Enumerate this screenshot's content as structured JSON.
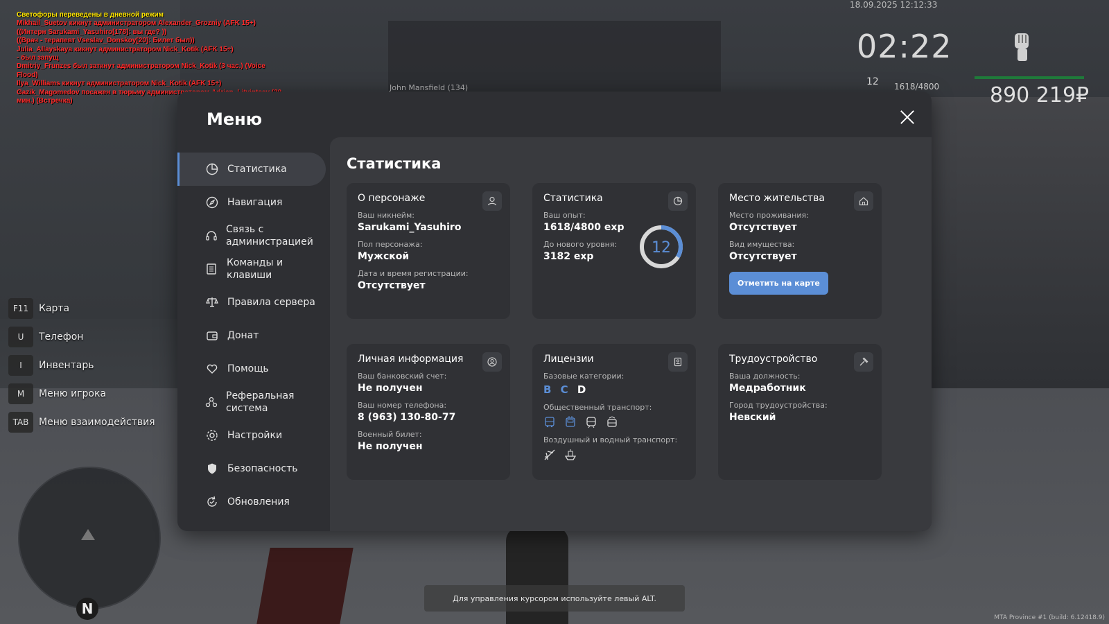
{
  "chat": {
    "lines": [
      "Светофоры переведены в дневной режим",
      "Mikhail_Suetov кикнут администратором Alexander_Grozniy (AFK 15+)",
      "((Интерн Sarukami_Yasuhiro[178]: вы где? ))",
      "((Врач - терапевт Vseslav_Donskoy[20]: Билет был))",
      "Julia_Allayskaya кикнут администратором Nick_Kotik (AFK 15+)",
      " - был запущ",
      "Dmitriy_Frunzes был заткнут администратором Nick_Kotik (3 час.) (Voice Flood)",
      "Ilya_Williams кикнут администратором Nick_Kotik (AFK 15+)",
      "Gazik_Magomedov посажен в тюрьму администратором Adrian_Litvintsev (30 мин.) (Встречка)"
    ]
  },
  "hud": {
    "datetime": "18.09.2025 12:12:33",
    "clock": "02:22",
    "level": "12",
    "exp": "1618/4800",
    "money": "890 219₽",
    "nametag": "John Mansfield (134)"
  },
  "hotkeys": [
    {
      "key": "F11",
      "label": "Карта"
    },
    {
      "key": "U",
      "label": "Телефон"
    },
    {
      "key": "I",
      "label": "Инвентарь"
    },
    {
      "key": "M",
      "label": "Меню игрока"
    },
    {
      "key": "TAB",
      "label": "Меню взаимодействия"
    }
  ],
  "minimap": {
    "north": "N"
  },
  "hint": "Для управления курсором используйте левый ALT.",
  "build": "MTA Province #1 (build: 6.12418.9)",
  "menu": {
    "title": "Меню",
    "sidebar": [
      {
        "label": "Статистика",
        "icon": "pie-chart-icon",
        "active": true
      },
      {
        "label": "Навигация",
        "icon": "compass-icon"
      },
      {
        "label": "Связь с администрацией",
        "icon": "headset-icon"
      },
      {
        "label": "Команды и клавиши",
        "icon": "document-icon"
      },
      {
        "label": "Правила сервера",
        "icon": "scales-icon"
      },
      {
        "label": "Донат",
        "icon": "wallet-icon"
      },
      {
        "label": "Помощь",
        "icon": "heart-hand-icon"
      },
      {
        "label": "Реферальная система",
        "icon": "referral-icon"
      },
      {
        "label": "Настройки",
        "icon": "gear-icon"
      },
      {
        "label": "Безопасность",
        "icon": "shield-icon"
      },
      {
        "label": "Обновления",
        "icon": "refresh-icon"
      }
    ],
    "content_title": "Статистика",
    "cards": {
      "character": {
        "title": "О персонаже",
        "nick_label": "Ваш никнейм:",
        "nick": "Sarukami_Yasuhiro",
        "gender_label": "Пол персонажа:",
        "gender": "Мужской",
        "reg_label": "Дата и время регистрации:",
        "reg": "Отсутствует"
      },
      "stats": {
        "title": "Статистика",
        "exp_label": "Ваш опыт:",
        "exp": "1618/4800 exp",
        "next_label": "До нового уровня:",
        "next": "3182 exp",
        "level": "12",
        "progress": 0.337
      },
      "residence": {
        "title": "Место жительства",
        "place_label": "Место проживания:",
        "place": "Отсутствует",
        "property_label": "Вид имущества:",
        "property": "Отсутствует",
        "button": "Отметить на карте"
      },
      "personal": {
        "title": "Личная информация",
        "bank_label": "Ваш банковский счет:",
        "bank": "Не получен",
        "phone_label": "Ваш номер телефона:",
        "phone": "8 (963) 130-80-77",
        "military_label": "Военный билет:",
        "military": "Не получен"
      },
      "licenses": {
        "title": "Лицензии",
        "base_label": "Базовые категории:",
        "cat_b": "B",
        "cat_c": "C",
        "cat_d": "D",
        "public_label": "Общественный транспорт:",
        "public_icons": [
          "bus-icon",
          "trolleybus-icon",
          "train-icon",
          "tram-icon"
        ],
        "air_label": "Воздушный и водный транспорт:",
        "air_icons": [
          "airplane-icon",
          "boat-icon"
        ]
      },
      "job": {
        "title": "Трудоустройство",
        "position_label": "Ваша должность:",
        "position": "Медработник",
        "city_label": "Город трудоустройства:",
        "city": "Невский"
      }
    }
  },
  "colors": {
    "accent": "#5b8ed6",
    "panel": "#2e2f33",
    "content": "#393a3e",
    "card": "#303135",
    "chat_red": "#ff2a2a",
    "chat_yellow": "#ffe600"
  }
}
